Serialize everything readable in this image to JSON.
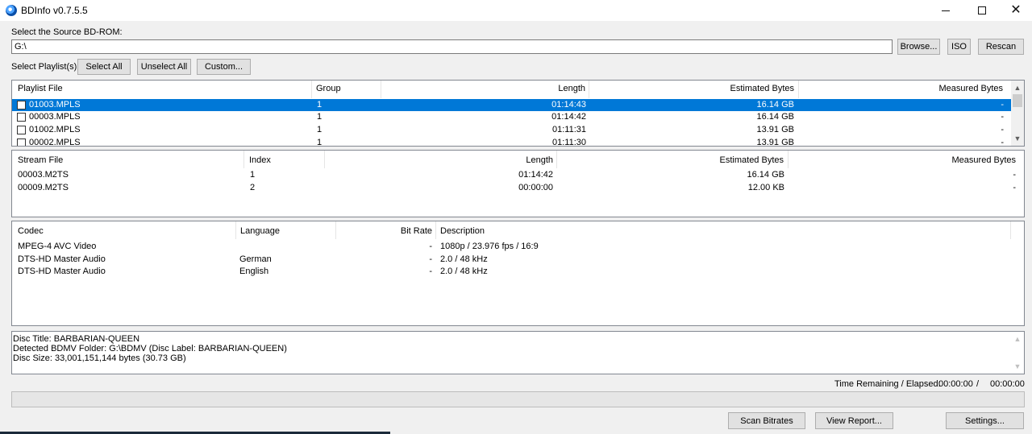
{
  "window": {
    "title": "BDInfo v0.7.5.5"
  },
  "source": {
    "label": "Select the Source BD-ROM:",
    "path": "G:\\",
    "browse": "Browse...",
    "iso": "ISO",
    "rescan": "Rescan"
  },
  "playlist_select": {
    "label": "Select Playlist(s):",
    "select_all": "Select All",
    "unselect_all": "Unselect All",
    "custom": "Custom..."
  },
  "playlists": {
    "headers": [
      "Playlist File",
      "Group",
      "Length",
      "Estimated Bytes",
      "Measured Bytes"
    ],
    "rows": [
      {
        "file": "01003.MPLS",
        "group": "1",
        "length": "01:14:43",
        "estimated": "16.14 GB",
        "measured": "-",
        "selected": true
      },
      {
        "file": "00003.MPLS",
        "group": "1",
        "length": "01:14:42",
        "estimated": "16.14 GB",
        "measured": "-",
        "selected": false
      },
      {
        "file": "01002.MPLS",
        "group": "1",
        "length": "01:11:31",
        "estimated": "13.91 GB",
        "measured": "-",
        "selected": false
      },
      {
        "file": "00002.MPLS",
        "group": "1",
        "length": "01:11:30",
        "estimated": "13.91 GB",
        "measured": "-",
        "selected": false
      }
    ]
  },
  "streams": {
    "headers": [
      "Stream File",
      "Index",
      "Length",
      "Estimated Bytes",
      "Measured Bytes"
    ],
    "rows": [
      {
        "file": "00003.M2TS",
        "index": "1",
        "length": "01:14:42",
        "estimated": "16.14 GB",
        "measured": "-"
      },
      {
        "file": "00009.M2TS",
        "index": "2",
        "length": "00:00:00",
        "estimated": "12.00 KB",
        "measured": "-"
      }
    ]
  },
  "codecs": {
    "headers": [
      "Codec",
      "Language",
      "Bit Rate",
      "Description"
    ],
    "rows": [
      {
        "codec": "MPEG-4 AVC Video",
        "language": "",
        "bitrate": "-",
        "description": "1080p / 23.976 fps / 16:9"
      },
      {
        "codec": "DTS-HD Master Audio",
        "language": "German",
        "bitrate": "-",
        "description": "2.0 / 48 kHz"
      },
      {
        "codec": "DTS-HD Master Audio",
        "language": "English",
        "bitrate": "-",
        "description": "2.0 / 48 kHz"
      }
    ]
  },
  "disc_info": {
    "lines": [
      "Disc Title: BARBARIAN-QUEEN",
      "Detected BDMV Folder: G:\\BDMV (Disc Label: BARBARIAN-QUEEN)",
      "Disc Size: 33,001,151,144 bytes (30.73 GB)"
    ]
  },
  "progress": {
    "label": "Time Remaining / Elapsed:",
    "remaining": "00:00:00",
    "separator": "/",
    "elapsed": "00:00:00",
    "fraction": 0
  },
  "actions": {
    "scan_bitrates": "Scan Bitrates",
    "view_report": "View Report...",
    "settings": "Settings..."
  },
  "icons": {
    "app": "bdinfo-disc-icon",
    "minimize": "minimize-icon",
    "maximize": "maximize-icon",
    "close": "close-icon"
  },
  "colors": {
    "selection": "#0078d7"
  }
}
